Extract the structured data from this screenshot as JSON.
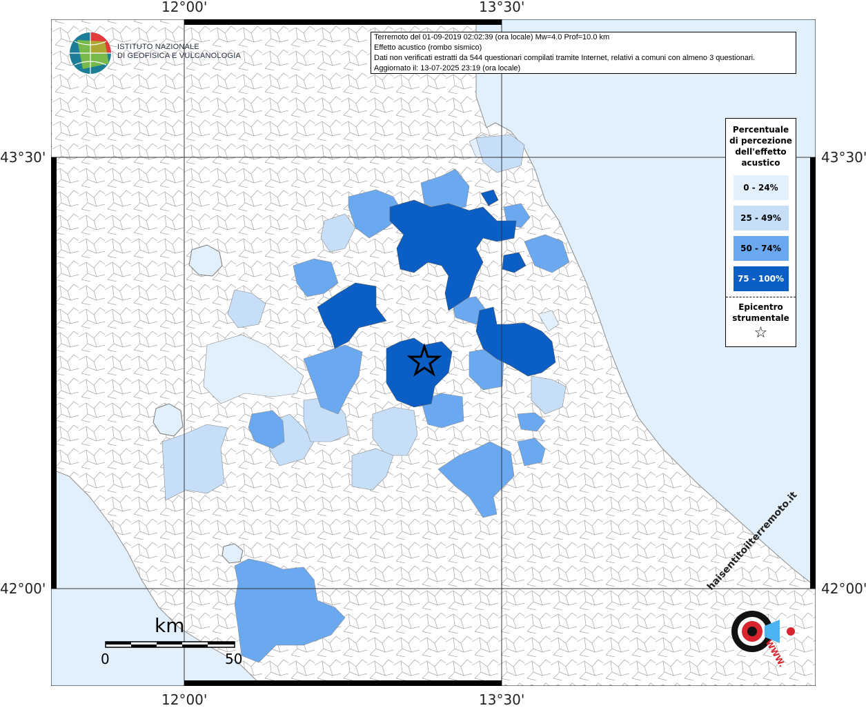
{
  "map": {
    "graticule": {
      "lon_labels": [
        "12°00'",
        "13°30'"
      ],
      "lat_labels": [
        "43°30'",
        "42°00'"
      ]
    },
    "info": {
      "line1": "Terremoto del 01-09-2019 02:02:39 (ora locale) Mw=4.0 Prof=10.0 km",
      "line2": "Effetto acustico (rombo sismico)",
      "line3": "Dati non verificati estratti da 544 questionari compilati tramite Internet, relativi a comuni con almeno 3 questionari.",
      "line4": "Aggiornato il: 13-07-2025 23:19 (ora locale)"
    },
    "legend": {
      "title": "Percentuale di percezione dell'effetto acustico",
      "title_lines": [
        "Percentuale",
        "di percezione",
        "dell'effetto",
        "acustico"
      ],
      "items": [
        {
          "label": "0 - 24%",
          "color": "#e2f0fc"
        },
        {
          "label": "25 - 49%",
          "color": "#c6def7"
        },
        {
          "label": "50 - 74%",
          "color": "#6aa8f0"
        },
        {
          "label": "75 - 100%",
          "color": "#0b5fc4"
        }
      ],
      "epicenter_lines": [
        "Epicentro",
        "strumentale"
      ],
      "epicenter_symbol": "☆"
    },
    "institute": {
      "name_line1": "ISTITUTO NAZIONALE",
      "name_line2": "DI GEOFISICA E VULCANOLOGIA"
    },
    "scalebar": {
      "unit": "km",
      "start": "0",
      "end": "50"
    },
    "watermark": {
      "text": "haisentitoilterremoto.it",
      "url": "WWW."
    },
    "colors": {
      "sea": "#e2f0fc",
      "land": "#ffffff",
      "borders": "#9a9a9a"
    }
  }
}
